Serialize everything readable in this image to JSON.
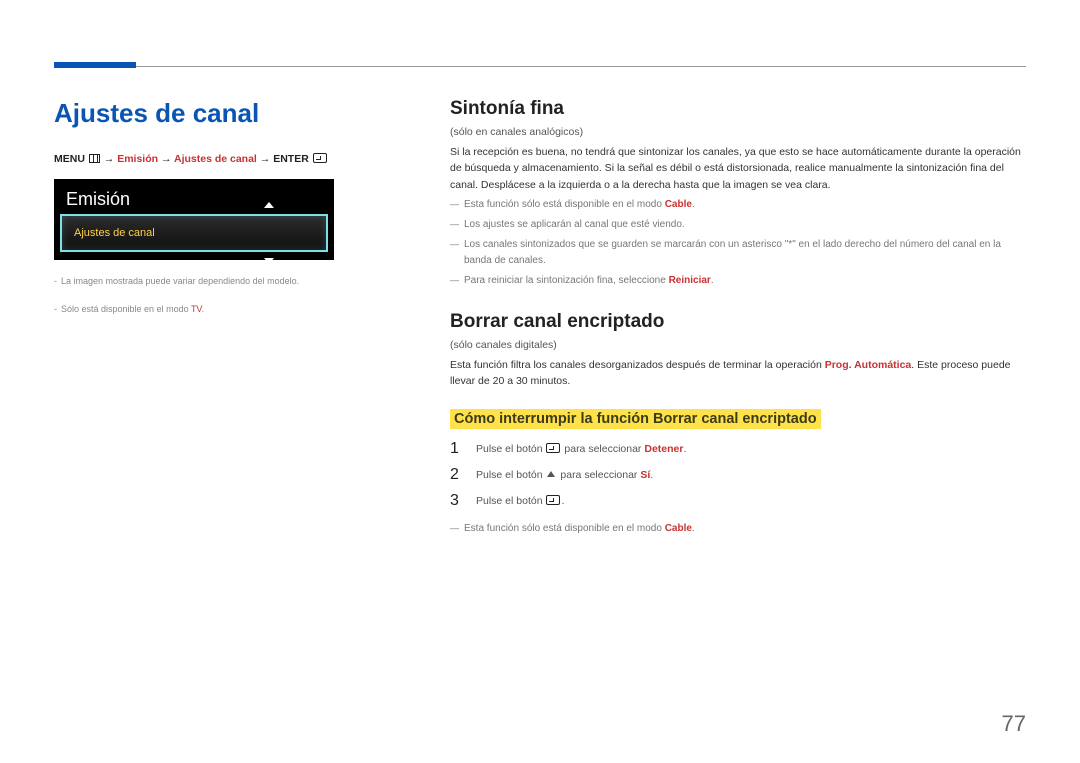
{
  "left": {
    "title": "Ajustes de canal",
    "menu_path": {
      "prefix": "MENU ",
      "seg1": "Emisión",
      "seg2": "Ajustes de canal",
      "suffix": "ENTER "
    },
    "tv": {
      "title": "Emisión",
      "row": "Ajustes de canal"
    },
    "notes": {
      "n1": "La imagen mostrada puede variar dependiendo del modelo.",
      "n2_pre": "Sólo está disponible en el modo ",
      "n2_accent": "TV",
      "n2_post": "."
    }
  },
  "right": {
    "sec1_title": "Sintonía fina",
    "sec1_paren": "(sólo en canales analógicos)",
    "sec1_body": "Si la recepción es buena, no tendrá que sintonizar los canales, ya que esto se hace automáticamente durante la operación de búsqueda y almacenamiento. Si la señal es débil o está distorsionada, realice manualmente la sintonización fina del canal. Desplácese a la izquierda o a la derecha hasta que la imagen se vea clara.",
    "sec1_d1_pre": "Esta función sólo está disponible en el modo ",
    "sec1_d1_accent": "Cable",
    "sec1_d1_post": ".",
    "sec1_d2": "Los ajustes se aplicarán al canal que esté viendo.",
    "sec1_d3": "Los canales sintonizados que se guarden se marcarán con un asterisco \"*\" en el lado derecho del número del canal en la banda de canales.",
    "sec1_d4_pre": "Para reiniciar la sintonización fina, seleccione ",
    "sec1_d4_accent": "Reiniciar",
    "sec1_d4_post": ".",
    "sec2_title": "Borrar canal encriptado",
    "sec2_paren": "(sólo canales digitales)",
    "sec2_body_pre": "Esta función filtra los canales desorganizados después de terminar la operación ",
    "sec2_body_accent": "Prog. Automática",
    "sec2_body_post": ". Este proceso puede llevar de 20 a 30 minutos.",
    "sec2_sub": "Cómo interrumpir la función Borrar canal encriptado",
    "steps": {
      "s1_pre": "Pulse el botón ",
      "s1_mid": " para seleccionar ",
      "s1_accent": "Detener",
      "s1_post": ".",
      "s2_pre": "Pulse el botón ",
      "s2_mid": " para seleccionar ",
      "s2_accent": "Sí",
      "s2_post": ".",
      "s3_pre": "Pulse el botón ",
      "s3_post": "."
    },
    "sec2_d1_pre": "Esta función sólo está disponible en el modo ",
    "sec2_d1_accent": "Cable",
    "sec2_d1_post": "."
  },
  "page_number": "77"
}
